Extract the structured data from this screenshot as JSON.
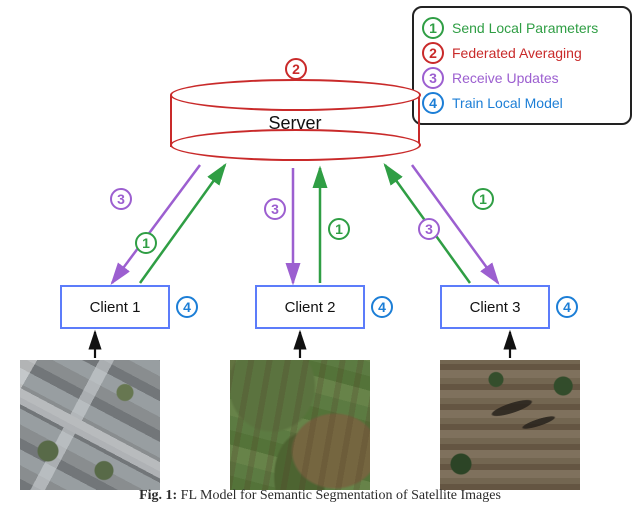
{
  "legend": {
    "items": [
      {
        "num": "1",
        "label": "Send Local Parameters"
      },
      {
        "num": "2",
        "label": "Federated Averaging"
      },
      {
        "num": "3",
        "label": "Receive Updates"
      },
      {
        "num": "4",
        "label": "Train Local Model"
      }
    ]
  },
  "server": {
    "label": "Server",
    "step": "2"
  },
  "clients": [
    {
      "label": "Client 1",
      "step": "4"
    },
    {
      "label": "Client 2",
      "step": "4"
    },
    {
      "label": "Client 3",
      "step": "4"
    }
  ],
  "arrow_steps": {
    "send": "1",
    "receive": "3"
  },
  "caption": {
    "strong": "Fig. 1:",
    "text": " FL Model for Semantic Segmentation of Satellite Images"
  },
  "colors": {
    "green": "#2f9e44",
    "red": "#c92a2a",
    "purple": "#9c5fd0",
    "blue": "#1c7ed6"
  }
}
